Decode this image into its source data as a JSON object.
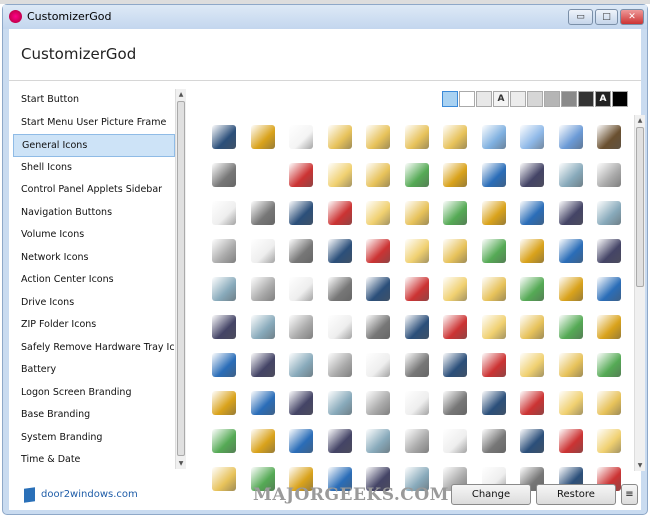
{
  "window": {
    "title": "CustomizerGod",
    "minimize": "▭",
    "maximize": "□",
    "close": "✕"
  },
  "header": {
    "title": "CustomizerGod"
  },
  "sidebar": {
    "selected": 2,
    "items": [
      "Start Button",
      "Start Menu User Picture Frame",
      "General Icons",
      "Shell Icons",
      "Control Panel Applets Sidebar",
      "Navigation Buttons",
      "Volume Icons",
      "Network Icons",
      "Action Center Icons",
      "Drive Icons",
      "ZIP Folder Icons",
      "Safely Remove Hardware Tray Icon",
      "Battery",
      "Logon Screen Branding",
      "Base Branding",
      "System Branding",
      "Time & Date"
    ]
  },
  "swatches": [
    {
      "color": "#a9d2f2",
      "label": ""
    },
    {
      "color": "#ffffff",
      "label": ""
    },
    {
      "color": "#e8e8e8",
      "label": ""
    },
    {
      "color": "#f4f4f4",
      "label": "A"
    },
    {
      "color": "#ececec",
      "label": ""
    },
    {
      "color": "#d6d6d6",
      "label": ""
    },
    {
      "color": "#b5b5b5",
      "label": ""
    },
    {
      "color": "#8a8a8a",
      "label": ""
    },
    {
      "color": "#333333",
      "label": ""
    },
    {
      "color": "#222222",
      "label": "A"
    },
    {
      "color": "#000000",
      "label": ""
    }
  ],
  "icon_colors": [
    "#2b4f7a",
    "#d9a21b",
    "#f4f4f4",
    "#e7c25a",
    "#e7c25a",
    "#e7c25a",
    "#e7c25a",
    "#7fb0e0",
    "#8fb9e8",
    "#6b9ad6",
    "#6a5030"
  ],
  "footer": {
    "link": "door2windows.com",
    "watermark": "MAJORGEEKS.COM",
    "change": "Change",
    "restore": "Restore",
    "menu": "≡"
  }
}
